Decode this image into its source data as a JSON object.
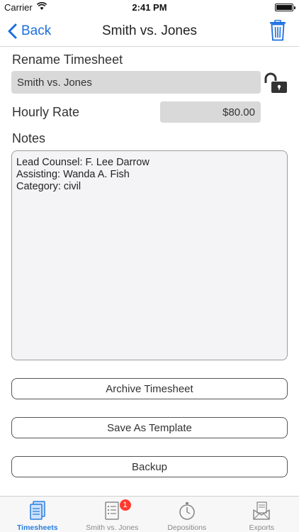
{
  "status_bar": {
    "carrier": "Carrier",
    "time": "2:41 PM"
  },
  "nav": {
    "back_label": "Back",
    "title": "Smith vs. Jones"
  },
  "form": {
    "rename_label": "Rename Timesheet",
    "rename_value": "Smith vs. Jones",
    "rate_label": "Hourly Rate",
    "rate_value": "$80.00",
    "notes_label": "Notes",
    "notes_value": "Lead Counsel: F. Lee Darrow\nAssisting: Wanda A. Fish\nCategory: civil"
  },
  "actions": {
    "archive_label": "Archive Timesheet",
    "template_label": "Save As Template",
    "backup_label": "Backup"
  },
  "tabs": [
    {
      "label": "Timesheets",
      "icon": "timesheets-icon",
      "active": true
    },
    {
      "label": "Smith vs. Jones",
      "icon": "list-document-icon",
      "badge": "1"
    },
    {
      "label": "Depositions",
      "icon": "stopwatch-icon"
    },
    {
      "label": "Exports",
      "icon": "mail-export-icon"
    }
  ],
  "colors": {
    "accent": "#1a6fe0",
    "active_tab": "#2a7fe0",
    "field_bg": "#d9d9d9",
    "badge": "#ff3b30"
  }
}
